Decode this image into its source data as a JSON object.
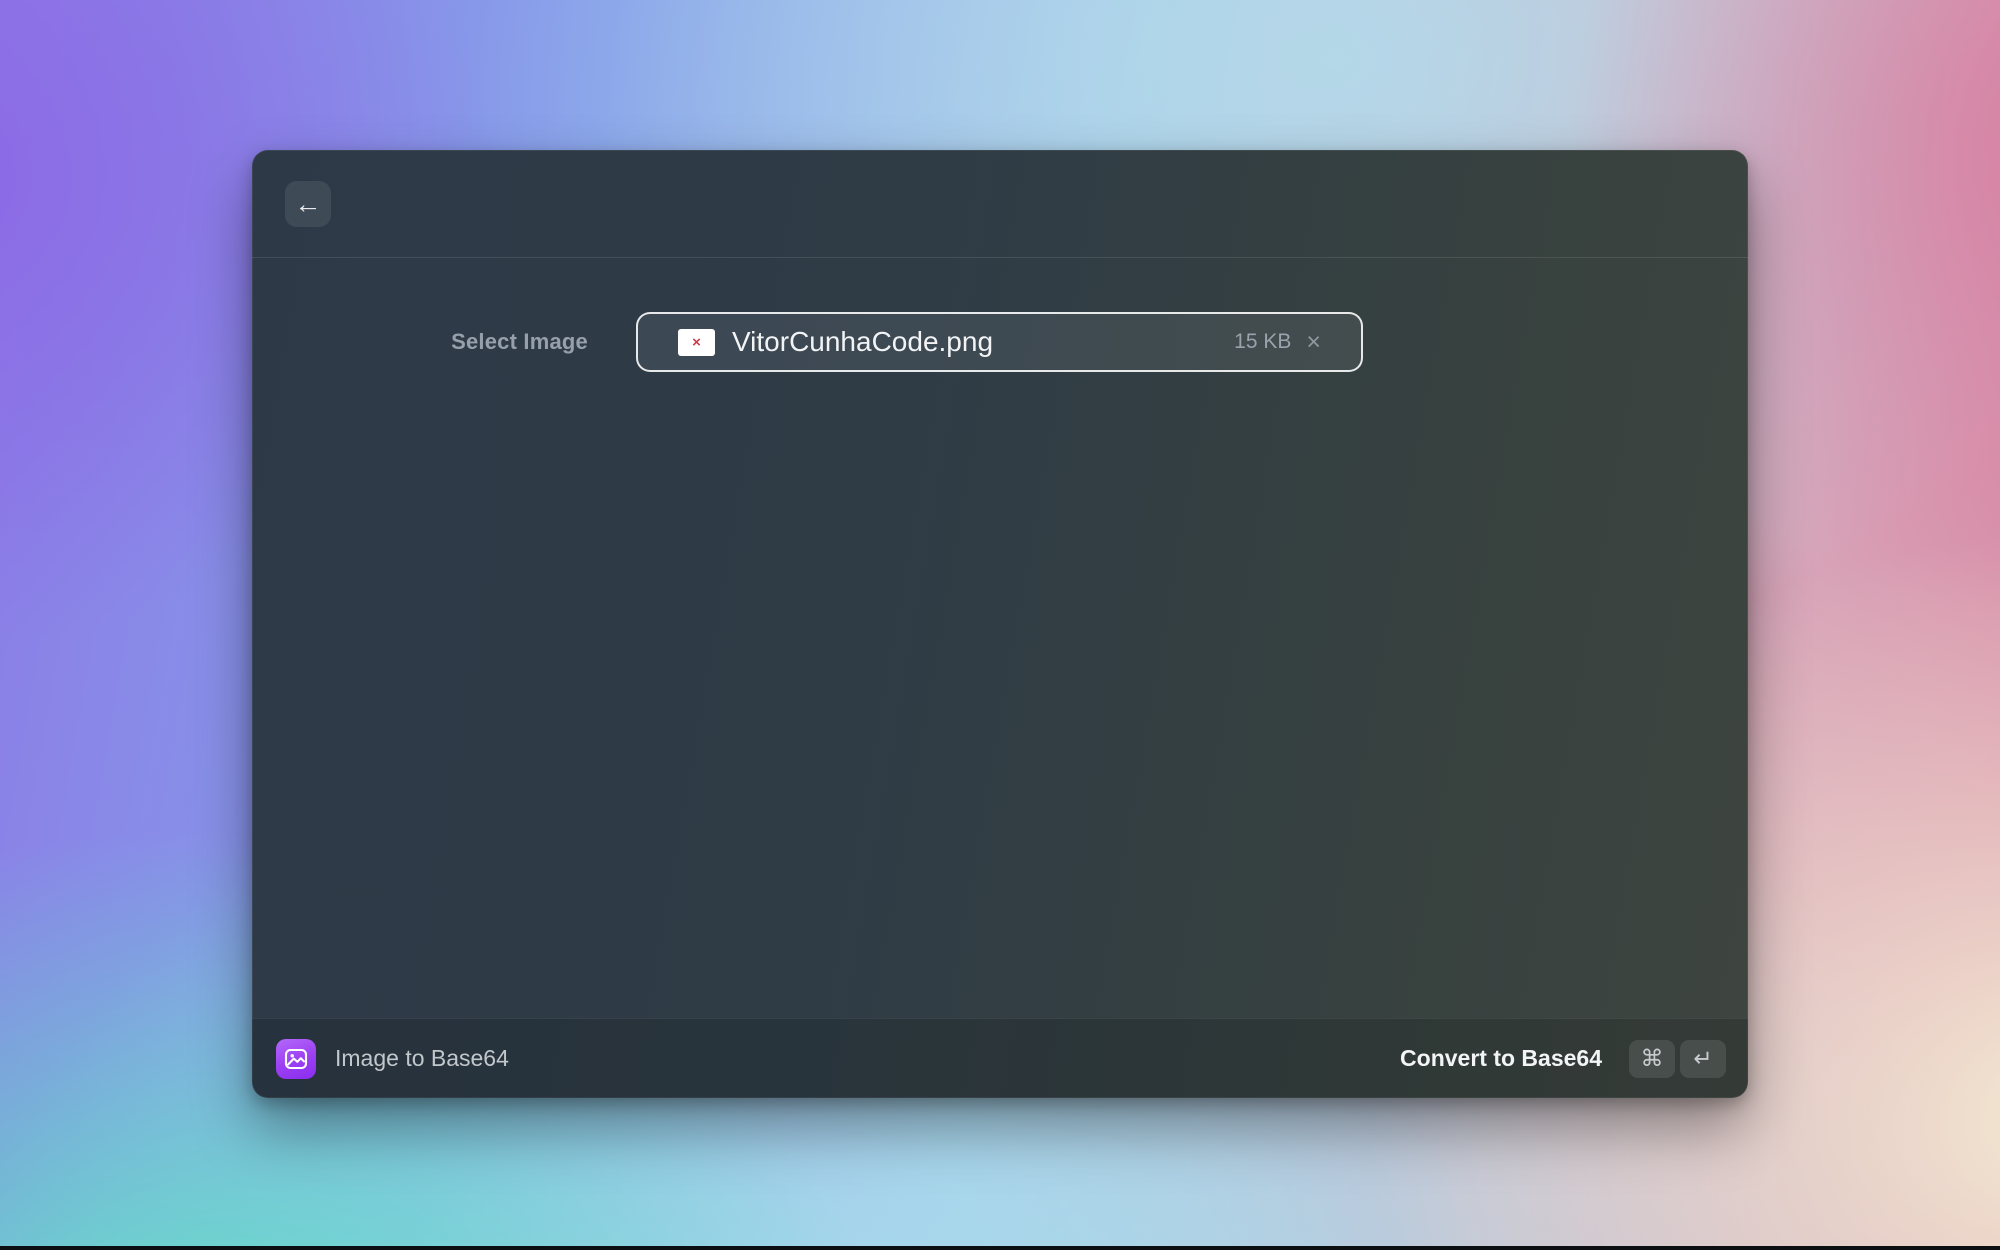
{
  "window": {
    "header": {
      "back_icon_glyph": "←"
    },
    "form": {
      "label": "Select Image",
      "file": {
        "name": "VitorCunhaCode.png",
        "size": "15 KB",
        "remove_glyph": "×",
        "broken_thumb_glyph": "×"
      }
    },
    "footer": {
      "title": "Image to Base64",
      "action": "Convert to Base64",
      "keys": [
        {
          "name": "cmd-key",
          "glyph": "⌘"
        },
        {
          "name": "return-key",
          "glyph": "↵"
        }
      ]
    }
  },
  "colors": {
    "accent_purple": "#9b3ff2",
    "thumb_error_red": "#d03b49",
    "window_bg_left": "#2d3947",
    "window_bg_right": "#3e4540",
    "chip_border": "#ffffff",
    "label_gray": "#97a0aa",
    "wallpaper": {
      "top_left_purple": "#8b7ae6",
      "top_blue": "#86a0ea",
      "top_right_pink": "#d98ba6",
      "bottom_left_teal": "#5fe8c3",
      "bottom_right_cream": "#f3ecd4"
    }
  }
}
